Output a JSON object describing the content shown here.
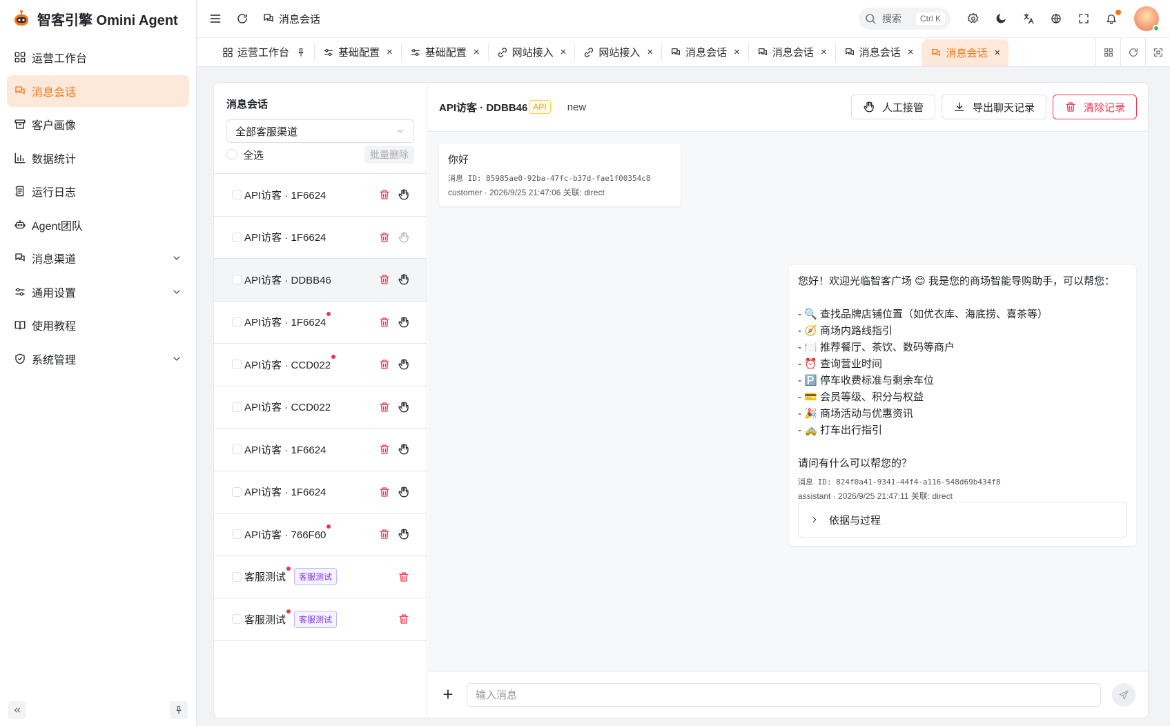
{
  "app": {
    "title": "智客引擎 Omini Agent"
  },
  "sidebar": {
    "items": [
      {
        "label": "运营工作台",
        "icon": "dashboard-icon"
      },
      {
        "label": "消息会话",
        "icon": "chat-icon",
        "active": true
      },
      {
        "label": "客户画像",
        "icon": "archive-icon"
      },
      {
        "label": "数据统计",
        "icon": "bar-chart-icon"
      },
      {
        "label": "运行日志",
        "icon": "log-icon"
      },
      {
        "label": "Agent团队",
        "icon": "team-icon"
      },
      {
        "label": "消息渠道",
        "icon": "chat-icon",
        "expandable": true
      },
      {
        "label": "通用设置",
        "icon": "sliders-icon",
        "expandable": true
      },
      {
        "label": "使用教程",
        "icon": "book-icon"
      },
      {
        "label": "系统管理",
        "icon": "shield-icon",
        "expandable": true
      }
    ]
  },
  "topbar": {
    "page_title": "消息会话",
    "search_label": "搜索",
    "search_shortcut": "Ctrl K"
  },
  "tabs": [
    {
      "label": "运营工作台",
      "icon": "dashboard-icon",
      "pinned": true
    },
    {
      "label": "基础配置",
      "icon": "sliders-icon"
    },
    {
      "label": "基础配置",
      "icon": "sliders-icon"
    },
    {
      "label": "网站接入",
      "icon": "link-icon"
    },
    {
      "label": "网站接入",
      "icon": "link-icon"
    },
    {
      "label": "消息会话",
      "icon": "chat-icon"
    },
    {
      "label": "消息会话",
      "icon": "chat-icon"
    },
    {
      "label": "消息会话",
      "icon": "chat-icon"
    },
    {
      "label": "消息会话",
      "icon": "chat-icon",
      "active": true
    }
  ],
  "conversations": {
    "title": "消息会话",
    "channel_select": "全部客服渠道",
    "select_all": "全选",
    "batch_delete": "批量删除",
    "items": [
      {
        "name": "API访客 · 1F6624",
        "unread": false,
        "takeover": true
      },
      {
        "name": "API访客 · 1F6624",
        "unread": false,
        "takeover": true,
        "takeover_dim": true
      },
      {
        "name": "API访客 · DDBB46",
        "unread": false,
        "takeover": true,
        "selected": true
      },
      {
        "name": "API访客 · 1F6624",
        "unread": true,
        "takeover": true
      },
      {
        "name": "API访客 · CCD022",
        "unread": true,
        "takeover": true
      },
      {
        "name": "API访客 · CCD022",
        "unread": false,
        "takeover": true
      },
      {
        "name": "API访客 · 1F6624",
        "unread": false,
        "takeover": true
      },
      {
        "name": "API访客 · 1F6624",
        "unread": false,
        "takeover": true
      },
      {
        "name": "API访客 · 766F60",
        "unread": true,
        "takeover": true
      },
      {
        "name": "客服测试",
        "unread": true,
        "takeover": false,
        "tag": "客服测试"
      },
      {
        "name": "客服测试",
        "unread": true,
        "takeover": false,
        "tag": "客服测试"
      }
    ]
  },
  "chat": {
    "title": "API访客 · DDBB46",
    "badge": "API",
    "status": "new",
    "buttons": {
      "takeover": "人工接管",
      "export": "导出聊天记录",
      "clear": "清除记录"
    },
    "messages": [
      {
        "role": "user",
        "text": "你好",
        "id_line": "消息 ID: 85985ae0-92ba-47fc-b37d-fae1f00354c8",
        "meta": "customer · 2026/9/25 21:47:06  关联: direct"
      },
      {
        "role": "assistant",
        "text": "您好！欢迎光临智客广场 😊 我是您的商场智能导购助手，可以帮您：\n\n- 🔍 查找品牌店铺位置（如优衣库、海底捞、喜茶等）\n- 🧭 商场内路线指引\n- 🍽️ 推荐餐厅、茶饮、数码等商户\n- ⏰ 查询营业时间\n- 🅿️ 停车收费标准与剩余车位\n- 💳 会员等级、积分与权益\n- 🎉 商场活动与优惠资讯\n- 🚕 打车出行指引\n\n请问有什么可以帮您的？",
        "id_line": "消息 ID: 824f0a41-9341-44f4-a116-548d69b434f8",
        "meta": "assistant · 2026/9/25 21:47:11  关联: direct",
        "evidence": "依据与过程"
      }
    ],
    "input_placeholder": "输入消息"
  }
}
